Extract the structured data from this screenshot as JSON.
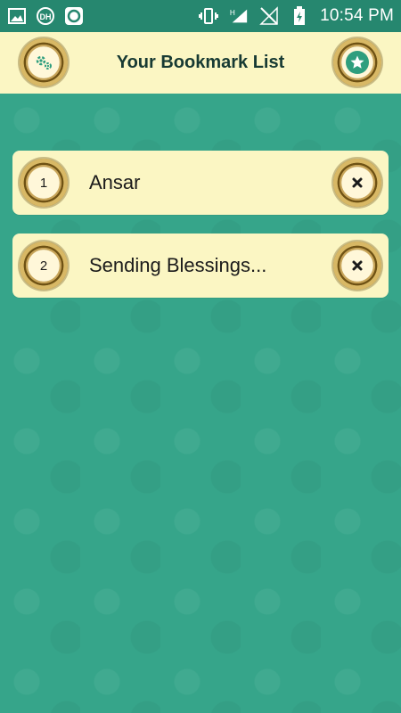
{
  "statusbar": {
    "time": "10:54 PM",
    "icons": [
      "image-icon",
      "dh-badge-icon",
      "circle-app-icon",
      "vibrate-icon",
      "signal-h-icon",
      "signal-off-icon",
      "battery-icon"
    ]
  },
  "header": {
    "title": "Your Bookmark List",
    "left_icon": "settings-icon",
    "right_icon": "star-icon"
  },
  "bookmarks": [
    {
      "number": "1",
      "title": "Ansar"
    },
    {
      "number": "2",
      "title": "Sending Blessings..."
    }
  ],
  "colors": {
    "background": "#36a58a",
    "statusbar": "#26876f",
    "header": "#fbf6c3",
    "card": "#fbf6c3",
    "accent_green": "#2f9e7e"
  }
}
